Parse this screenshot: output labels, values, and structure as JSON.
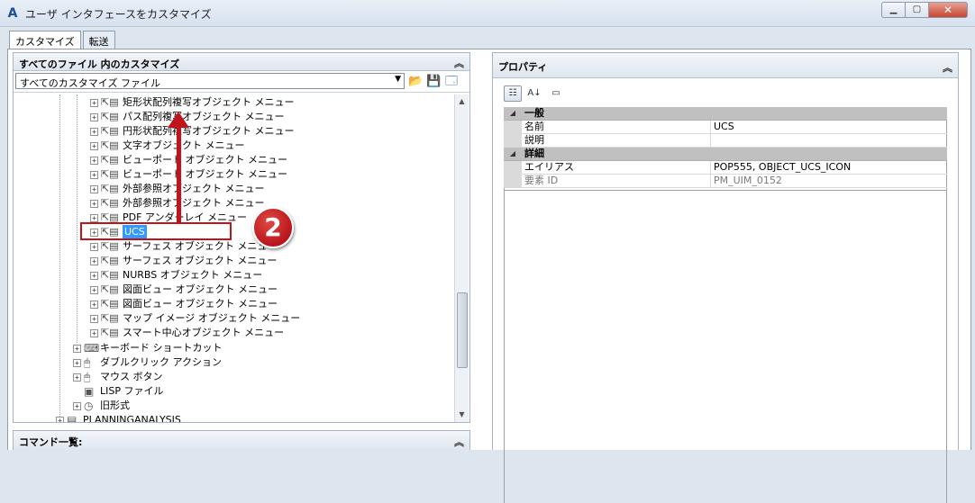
{
  "window": {
    "title": "ユーザ インタフェースをカスタマイズ",
    "app_icon": "A",
    "min_glyph": "▁",
    "max_glyph": "▢",
    "close_glyph": "✕"
  },
  "tabs": [
    {
      "label": "カスタマイズ",
      "active": true
    },
    {
      "label": "転送",
      "active": false
    }
  ],
  "left_panel": {
    "title": "すべてのファイル 内のカスタマイズ",
    "collapse_glyph": "︽",
    "file_select": "すべてのカスタマイズ ファイル",
    "tree_items": [
      "矩形状配列複写オブジェクト メニュー",
      "パス配列複写オブジェクト メニュー",
      "円形状配列複写オブジェクト メニュー",
      "文字オブジェクト メニュー",
      "ビューポート オブジェクト メニュー",
      "ビューポート オブジェクト メニュー",
      "外部参照オブジェクト メニュー",
      "外部参照オブジェクト メニュー",
      "PDF アンダーレイ メニュー",
      "UCS",
      "サーフェス オブジェクト メニュー",
      "サーフェス オブジェクト メニュー",
      "NURBS オブジェクト メニュー",
      "図面ビュー オブジェクト メニュー",
      "図面ビュー オブジェクト メニュー",
      "マップ イメージ オブジェクト メニュー",
      "スマート中心オブジェクト メニュー"
    ],
    "parent_items": [
      "キーボード ショートカット",
      "ダブルクリック アクション",
      "マウス ボタン",
      "LISP ファイル",
      "旧形式",
      "PLANNINGANALYSIS"
    ]
  },
  "command_panel": {
    "title": "コマンド一覧:"
  },
  "properties": {
    "title": "プロパティ",
    "categories": [
      {
        "name": "一般",
        "rows": [
          {
            "name": "名前",
            "value": "UCS",
            "readonly": false
          },
          {
            "name": "説明",
            "value": "",
            "readonly": false
          }
        ]
      },
      {
        "name": "詳細",
        "rows": [
          {
            "name": "エイリアス",
            "value": "POP555, OBJECT_UCS_ICON",
            "readonly": false
          },
          {
            "name": "要素 ID",
            "value": "PM_UIM_0152",
            "readonly": true
          }
        ]
      }
    ]
  },
  "annotation": {
    "step_number": "2",
    "colors": {
      "accent": "#c0141c",
      "selection": "#3399ff"
    }
  }
}
